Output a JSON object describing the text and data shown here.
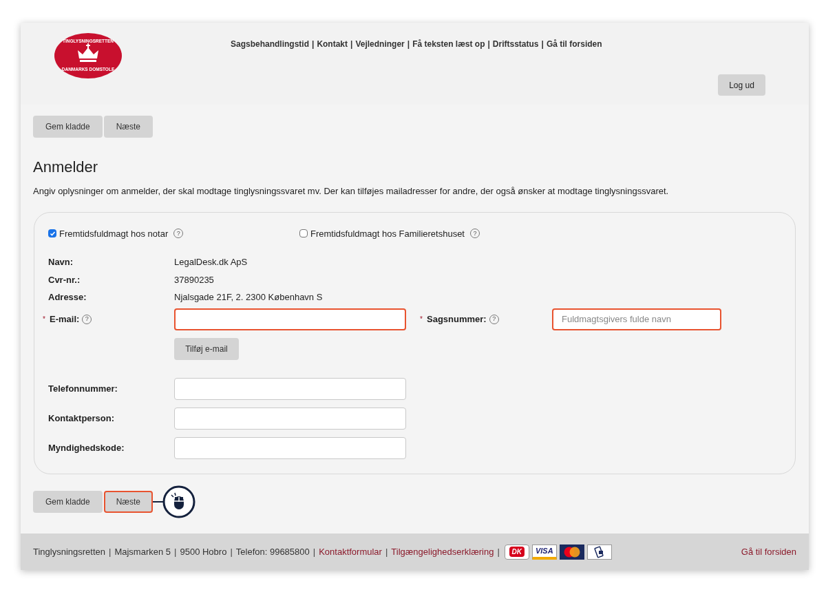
{
  "header": {
    "logo": {
      "top_text": "TINGLYSNINGSRETTEN",
      "bottom_text": "DANMARKS DOMSTOLE"
    },
    "separator": "|",
    "nav_links": [
      "Sagsbehandlingstid",
      "Kontakt",
      "Vejledninger",
      "Få teksten læst op",
      "Driftsstatus",
      "Gå til forsiden"
    ],
    "logout_button": "Log ud"
  },
  "top_buttons": [
    {
      "label": "Gem kladde",
      "highlighted": false,
      "click_marker": false
    },
    {
      "label": "Næste",
      "highlighted": false,
      "click_marker": false
    }
  ],
  "title": "Anmelder",
  "description": "Angiv oplysninger om anmelder, der skal modtage tinglysningssvaret mv. Der kan tilføjes mailadresser for andre, der også ønsker at modtage tinglysningssvaret.",
  "form": {
    "options": [
      {
        "label": "Fremtidsfuldmagt hos notar",
        "checked": true,
        "help": "?"
      },
      {
        "label": "Fremtidsfuldmagt hos Familieretshuset",
        "checked": false,
        "help": "?"
      }
    ],
    "info": [
      {
        "label": "Navn:",
        "value": "LegalDesk.dk ApS"
      },
      {
        "label": "Cvr-nr.:",
        "value": "37890235"
      },
      {
        "label": "Adresse:",
        "value": "Njalsgade 21F, 2. 2300 København S"
      }
    ],
    "email": {
      "label": "E-mail:",
      "required": "*",
      "help": "?",
      "highlighted": true
    },
    "case_number": {
      "label": "Sagsnummer:",
      "required": "*",
      "help": "?",
      "highlighted": true,
      "placeholder": "Fuldmagtsgivers fulde navn"
    },
    "add_email_button": "Tilføj e-mail",
    "contact_fields": [
      {
        "label": "Telefonnummer:",
        "highlighted": false
      },
      {
        "label": "Kontaktperson:",
        "highlighted": false
      },
      {
        "label": "Myndighedskode:",
        "highlighted": false
      }
    ]
  },
  "bottom_buttons": [
    {
      "label": "Gem kladde",
      "highlighted": false,
      "click_marker": false
    },
    {
      "label": "Næste",
      "highlighted": true,
      "click_marker": true
    }
  ],
  "footer": {
    "separator": "|",
    "items": [
      {
        "text": "Tinglysningsretten",
        "kind": "text"
      },
      {
        "text": "Majsmarken 5",
        "kind": "text"
      },
      {
        "text": "9500 Hobro",
        "kind": "text"
      },
      {
        "text": "Telefon: 99685800",
        "kind": "text"
      },
      {
        "text": "Kontaktformular",
        "kind": "link"
      },
      {
        "text": "Tilgængelighedserklæring",
        "kind": "link"
      }
    ],
    "payment_logos": [
      {
        "kind": "dk",
        "label": "DK"
      },
      {
        "kind": "visa",
        "label": "VISA"
      },
      {
        "kind": "mastercard"
      },
      {
        "kind": "mobilepay"
      }
    ],
    "home_link": "Gå til forsiden"
  }
}
